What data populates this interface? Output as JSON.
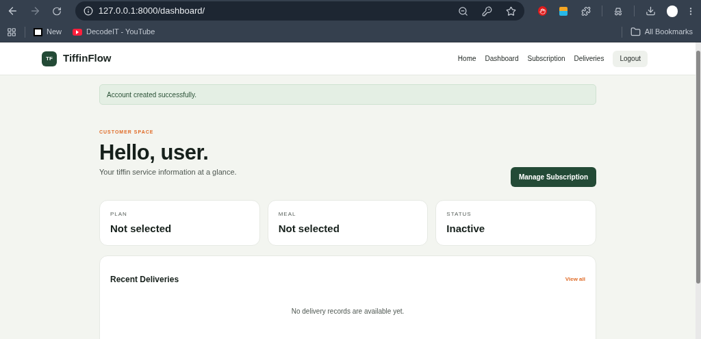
{
  "browser": {
    "url": "127.0.0.1:8000/dashboard/",
    "bookmarks": [
      {
        "kind": "logo",
        "label": "New"
      },
      {
        "kind": "video",
        "label": "DecodeIT - YouTube"
      }
    ],
    "all_bookmarks": "All Bookmarks"
  },
  "nav": {
    "logo": "TF",
    "brand": "TiffinFlow",
    "links": [
      "Home",
      "Dashboard",
      "Subscription",
      "Deliveries"
    ],
    "logout": "Logout"
  },
  "alert": "Account created successfully.",
  "eyebrow": "CUSTOMER SPACE",
  "heading": "Hello, user.",
  "subtitle": "Your tiffin service information at a glance.",
  "action": "Manage Subscription",
  "cards": [
    {
      "label": "PLAN",
      "value": "Not selected"
    },
    {
      "label": "MEAL",
      "value": "Not selected"
    },
    {
      "label": "STATUS",
      "value": "Inactive"
    }
  ],
  "deliveries": {
    "title": "Recent Deliveries",
    "link": "View all",
    "empty": "No delivery records are available yet."
  }
}
